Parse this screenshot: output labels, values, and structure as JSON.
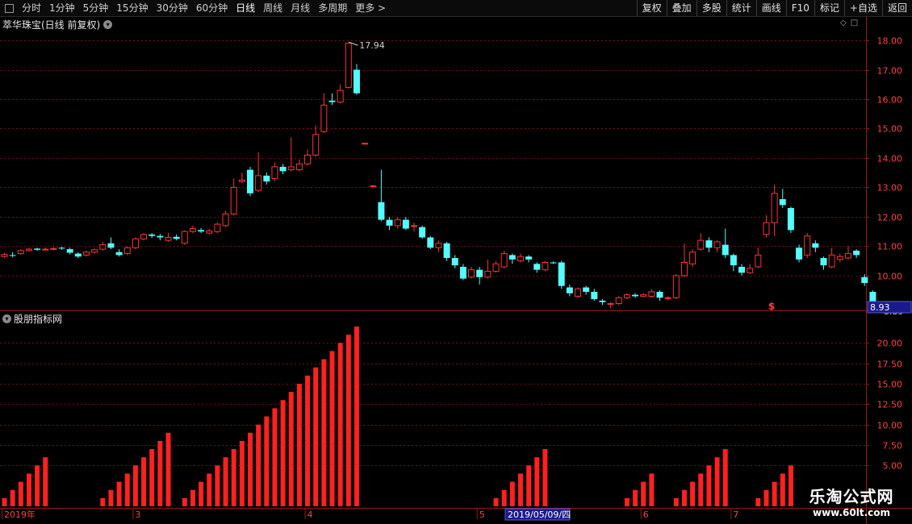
{
  "toolbar": {
    "periods": [
      "分时",
      "1分钟",
      "5分钟",
      "15分钟",
      "30分钟",
      "60分钟",
      "日线",
      "周线",
      "月线",
      "多周期",
      "更多 >"
    ],
    "active_index": 6,
    "right_buttons": [
      "复权",
      "叠加",
      "多股",
      "统计",
      "画线",
      "F10",
      "标记",
      "+自选",
      "返回"
    ]
  },
  "stock": {
    "title": "萃华珠宝(日线 前复权)"
  },
  "indicator": {
    "title": "股朋指标网"
  },
  "price_axis": {
    "labels": [
      "18.00",
      "17.00",
      "16.00",
      "15.00",
      "14.00",
      "13.00",
      "12.00",
      "11.00",
      "10.00"
    ],
    "current_price": "8.93",
    "high_label": "17.94",
    "low_label": "8.89",
    "signal_mark": "$"
  },
  "indicator_axis": {
    "labels": [
      "20.00",
      "17.50",
      "15.00",
      "12.50",
      "10.00",
      "7.50",
      "5.00"
    ]
  },
  "date_axis": {
    "labels": [
      {
        "text": "2019年",
        "index": 0
      },
      {
        "text": "3",
        "index": 16
      },
      {
        "text": "4",
        "index": 37
      },
      {
        "text": "5",
        "index": 58
      },
      {
        "text": "6",
        "index": 78
      },
      {
        "text": "7",
        "index": 89
      }
    ],
    "cursor_date": "2019/05/09/四"
  },
  "watermark": {
    "title": "乐淘公式网",
    "url": "www.60lt.com"
  },
  "colors": {
    "up": "#ff3232",
    "down": "#54fcfc",
    "bar": "#ff2020",
    "grid": "#7a1010",
    "axis": "#9c1818",
    "label": "#ff4040"
  },
  "chart_data": {
    "type": "candlestick",
    "price_range": [
      9.45,
      18.33
    ],
    "candles": [
      [
        10.65,
        10.72,
        10.78,
        10.6
      ],
      [
        10.7,
        10.68,
        10.8,
        10.62
      ],
      [
        10.75,
        10.85,
        10.9,
        10.7
      ],
      [
        10.85,
        10.9,
        10.95,
        10.82
      ],
      [
        10.92,
        10.88,
        10.95,
        10.84
      ],
      [
        10.88,
        10.9,
        10.96,
        10.85
      ],
      [
        10.9,
        10.92,
        10.97,
        10.86
      ],
      [
        10.95,
        10.92,
        10.98,
        10.88
      ],
      [
        10.9,
        10.78,
        10.95,
        10.72
      ],
      [
        10.75,
        10.65,
        10.8,
        10.6
      ],
      [
        10.7,
        10.8,
        10.85,
        10.65
      ],
      [
        10.8,
        10.88,
        10.92,
        10.75
      ],
      [
        10.9,
        11.05,
        11.15,
        10.85
      ],
      [
        11.1,
        10.95,
        11.3,
        10.9
      ],
      [
        10.8,
        10.7,
        10.9,
        10.65
      ],
      [
        10.75,
        10.95,
        11.0,
        10.7
      ],
      [
        10.95,
        11.25,
        11.3,
        10.9
      ],
      [
        11.25,
        11.4,
        11.45,
        11.2
      ],
      [
        11.4,
        11.35,
        11.45,
        11.28
      ],
      [
        11.35,
        11.3,
        11.42,
        11.2
      ],
      [
        11.2,
        11.3,
        11.45,
        11.15
      ],
      [
        11.32,
        11.25,
        11.4,
        11.2
      ],
      [
        11.1,
        11.5,
        11.55,
        11.05
      ],
      [
        11.5,
        11.6,
        11.7,
        11.45
      ],
      [
        11.55,
        11.5,
        11.62,
        11.45
      ],
      [
        11.45,
        11.52,
        11.6,
        11.4
      ],
      [
        11.5,
        11.75,
        11.8,
        11.45
      ],
      [
        11.7,
        12.1,
        12.2,
        11.65
      ],
      [
        12.1,
        13.0,
        13.3,
        12.05
      ],
      [
        13.2,
        13.25,
        13.5,
        13.15
      ],
      [
        13.6,
        12.8,
        13.7,
        12.7
      ],
      [
        12.9,
        13.4,
        14.2,
        12.85
      ],
      [
        13.4,
        13.2,
        13.5,
        13.1
      ],
      [
        13.3,
        13.7,
        13.85,
        13.2
      ],
      [
        13.7,
        13.55,
        13.8,
        13.45
      ],
      [
        13.6,
        13.7,
        14.7,
        13.55
      ],
      [
        13.6,
        13.8,
        13.95,
        13.55
      ],
      [
        13.8,
        14.1,
        14.3,
        13.75
      ],
      [
        14.1,
        14.8,
        15.1,
        14.05
      ],
      [
        14.9,
        15.8,
        16.2,
        14.85
      ],
      [
        15.95,
        15.9,
        16.2,
        15.8
      ],
      [
        15.9,
        16.3,
        16.5,
        15.85
      ],
      [
        16.4,
        17.9,
        17.94,
        16.35
      ],
      [
        17.0,
        16.2,
        17.2,
        16.15
      ],
      [
        14.5,
        14.5,
        14.52,
        14.48
      ],
      [
        13.05,
        13.05,
        13.08,
        13.02
      ],
      [
        12.5,
        11.9,
        13.6,
        11.85
      ],
      [
        11.9,
        11.7,
        12.0,
        11.55
      ],
      [
        11.7,
        11.9,
        12.0,
        11.6
      ],
      [
        11.9,
        11.6,
        12.0,
        11.55
      ],
      [
        11.7,
        11.7,
        11.8,
        11.5
      ],
      [
        11.65,
        11.3,
        11.7,
        11.25
      ],
      [
        11.3,
        10.95,
        11.35,
        10.9
      ],
      [
        10.95,
        11.1,
        11.2,
        10.8
      ],
      [
        11.1,
        10.6,
        11.15,
        10.5
      ],
      [
        10.6,
        10.35,
        10.7,
        10.25
      ],
      [
        10.3,
        9.9,
        10.4,
        9.85
      ],
      [
        9.95,
        10.2,
        10.3,
        9.9
      ],
      [
        10.2,
        9.95,
        10.3,
        9.7
      ],
      [
        9.95,
        10.15,
        10.55,
        9.9
      ],
      [
        10.15,
        10.4,
        10.5,
        10.1
      ],
      [
        10.3,
        10.75,
        10.85,
        10.25
      ],
      [
        10.7,
        10.55,
        10.75,
        10.4
      ],
      [
        10.5,
        10.65,
        10.75,
        10.45
      ],
      [
        10.65,
        10.55,
        10.7,
        10.45
      ],
      [
        10.4,
        10.2,
        10.45,
        10.1
      ],
      [
        10.2,
        10.45,
        10.5,
        10.15
      ],
      [
        10.45,
        10.42,
        10.48,
        10.4
      ],
      [
        10.45,
        9.65,
        10.5,
        9.55
      ],
      [
        9.6,
        9.4,
        9.7,
        9.3
      ],
      [
        9.3,
        9.55,
        9.6,
        9.25
      ],
      [
        9.6,
        9.45,
        9.65,
        9.35
      ],
      [
        9.45,
        9.2,
        9.55,
        9.15
      ],
      [
        9.15,
        9.1,
        9.2,
        9.0
      ],
      [
        9.05,
        9.05,
        9.1,
        8.89
      ],
      [
        9.05,
        9.25,
        9.3,
        9.0
      ],
      [
        9.25,
        9.35,
        9.4,
        9.2
      ],
      [
        9.35,
        9.3,
        9.4,
        9.25
      ],
      [
        9.3,
        9.35,
        9.4,
        9.28
      ],
      [
        9.3,
        9.45,
        9.55,
        9.25
      ],
      [
        9.45,
        9.25,
        9.5,
        9.15
      ],
      [
        9.25,
        9.25,
        9.3,
        9.15
      ],
      [
        9.25,
        10.0,
        10.05,
        9.2
      ],
      [
        10.0,
        10.45,
        11.1,
        9.95
      ],
      [
        10.4,
        10.8,
        10.9,
        10.3
      ],
      [
        10.9,
        11.2,
        11.45,
        10.85
      ],
      [
        11.2,
        10.95,
        11.3,
        10.8
      ],
      [
        10.95,
        11.15,
        11.2,
        10.8
      ],
      [
        11.05,
        10.7,
        11.6,
        10.6
      ],
      [
        10.7,
        10.35,
        10.75,
        10.15
      ],
      [
        10.3,
        10.1,
        10.4,
        10.0
      ],
      [
        10.1,
        10.25,
        10.4,
        10.05
      ],
      [
        10.3,
        10.7,
        10.95,
        10.25
      ],
      [
        11.4,
        11.8,
        12.05,
        11.3
      ],
      [
        11.8,
        12.8,
        13.1,
        11.35
      ],
      [
        12.6,
        12.4,
        12.95,
        12.3
      ],
      [
        12.3,
        11.55,
        12.35,
        11.45
      ],
      [
        10.95,
        10.55,
        11.05,
        10.45
      ],
      [
        10.7,
        11.35,
        11.45,
        10.6
      ],
      [
        11.1,
        10.95,
        11.2,
        10.8
      ],
      [
        10.6,
        10.35,
        10.65,
        10.2
      ],
      [
        10.3,
        10.7,
        10.95,
        10.25
      ],
      [
        10.55,
        10.65,
        10.75,
        10.45
      ],
      [
        10.6,
        10.75,
        11.0,
        10.55
      ],
      [
        10.85,
        10.7,
        10.9,
        10.6
      ],
      [
        9.95,
        9.75,
        10.05,
        9.65
      ],
      [
        9.45,
        8.93,
        9.5,
        8.85
      ]
    ],
    "indicator": {
      "range": [
        0,
        22.5
      ],
      "values": [
        1,
        2,
        3,
        4,
        5,
        6,
        0,
        0,
        0,
        0,
        0,
        0,
        1,
        2,
        3,
        4,
        5,
        6,
        7,
        8,
        9,
        0,
        1,
        2,
        3,
        4,
        5,
        6,
        7,
        8,
        9,
        10,
        11,
        12,
        13,
        14,
        15,
        16,
        17,
        18,
        19,
        20,
        21,
        22,
        0,
        0,
        0,
        0,
        0,
        0,
        0,
        0,
        0,
        0,
        0,
        0,
        0,
        0,
        0,
        0,
        1,
        2,
        3,
        4,
        5,
        6,
        7,
        0,
        0,
        0,
        0,
        0,
        0,
        0,
        0,
        0,
        1,
        2,
        3,
        4,
        0,
        0,
        1,
        2,
        3,
        4,
        5,
        6,
        7,
        0,
        0,
        0,
        1,
        2,
        3,
        4,
        5,
        0,
        0,
        0,
        0,
        0,
        0,
        0,
        0
      ]
    }
  }
}
